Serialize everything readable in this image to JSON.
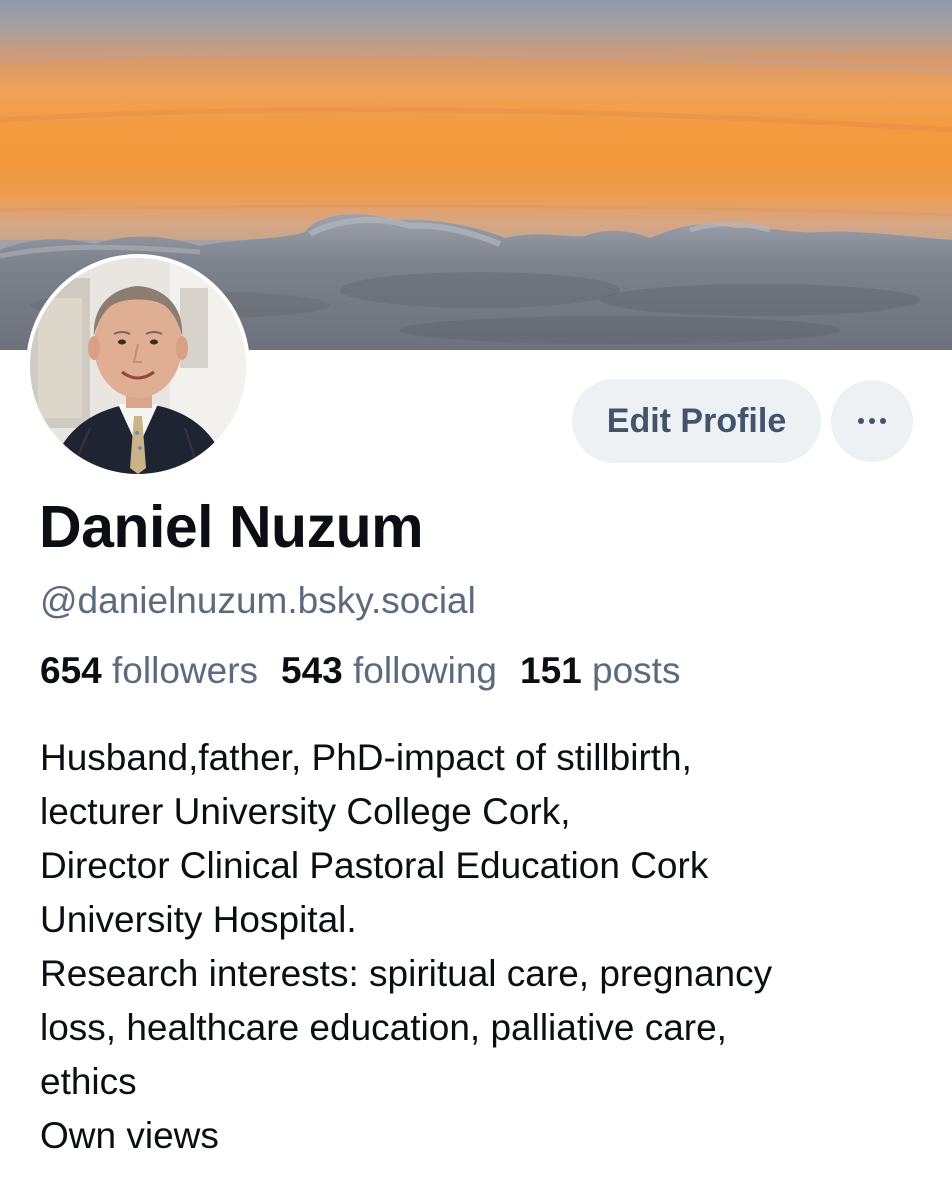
{
  "profile": {
    "display_name": "Daniel Nuzum",
    "handle": "@danielnuzum.bsky.social",
    "edit_label": "Edit Profile",
    "more_icon": "ellipsis-icon",
    "avatar_icon": "profile-photo",
    "banner_icon": "sunset-clouds-banner"
  },
  "stats": {
    "followers_count": "654",
    "followers_label": "followers",
    "following_count": "543",
    "following_label": "following",
    "posts_count": "151",
    "posts_label": "posts"
  },
  "bio": {
    "lines": [
      "Husband,father, PhD-impact of stillbirth,",
      "lecturer University College Cork,",
      "Director Clinical Pastoral Education Cork",
      "University Hospital.",
      "Research interests: spiritual care, pregnancy",
      "loss, healthcare education, palliative care,",
      "ethics",
      "Own views"
    ]
  },
  "colors": {
    "button_bg": "#eef1f4",
    "button_text": "#41546b",
    "muted_text": "#5b6b7c",
    "primary_text": "#0b0f14"
  }
}
